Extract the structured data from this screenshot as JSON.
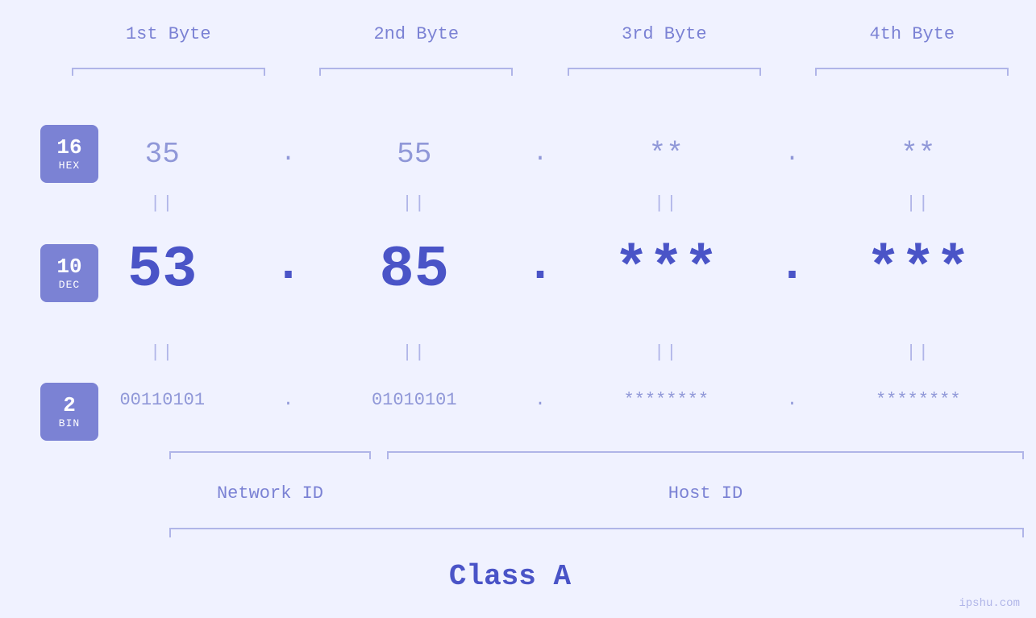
{
  "header": {
    "bytes": [
      "1st Byte",
      "2nd Byte",
      "3rd Byte",
      "4th Byte"
    ]
  },
  "badges": [
    {
      "id": "hex",
      "num": "16",
      "label": "HEX"
    },
    {
      "id": "dec",
      "num": "10",
      "label": "DEC"
    },
    {
      "id": "bin",
      "num": "2",
      "label": "BIN"
    }
  ],
  "hex_values": [
    "35",
    "55",
    "**",
    "**"
  ],
  "dec_values": [
    "53",
    "85",
    "***",
    "***"
  ],
  "bin_values": [
    "00110101",
    "01010101",
    "********",
    "********"
  ],
  "separators": [
    ".",
    ".",
    ".",
    ""
  ],
  "labels": {
    "network_id": "Network ID",
    "host_id": "Host ID",
    "class": "Class A"
  },
  "watermark": "ipshu.com"
}
